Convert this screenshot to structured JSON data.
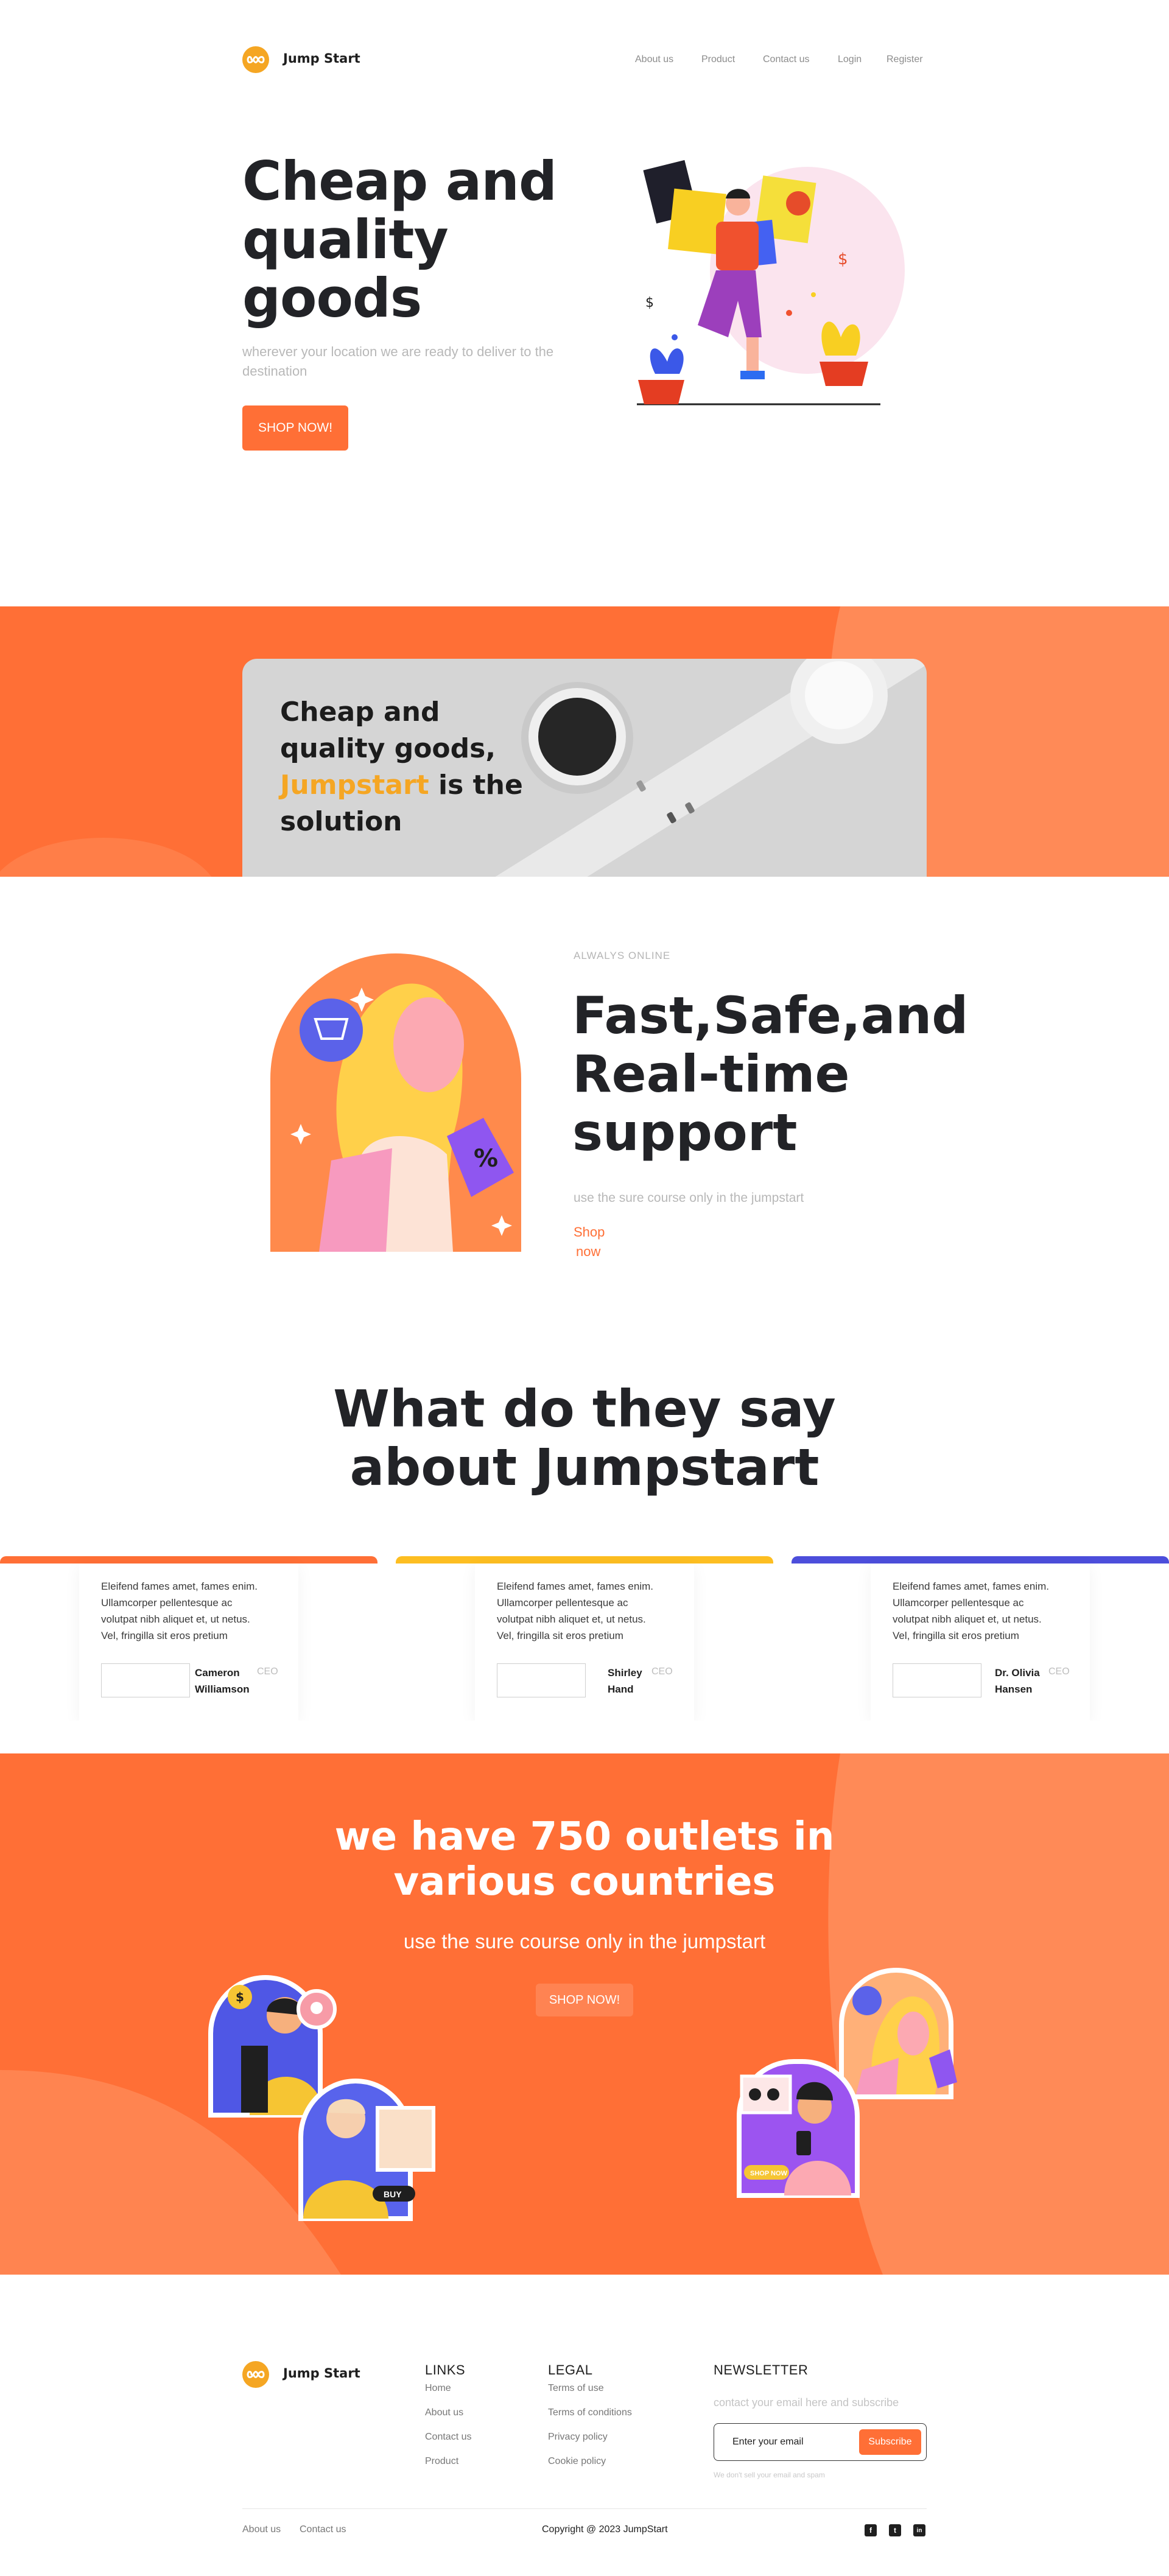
{
  "brand": {
    "name": "Jump Start",
    "accent": "#FF6F36",
    "logo_color": "#F5A623"
  },
  "nav": {
    "items": [
      "About us",
      "Product",
      "Contact us",
      "Login",
      "Register"
    ]
  },
  "hero": {
    "title_lines": [
      "Cheap and",
      "quality",
      "goods"
    ],
    "subtitle": "wherever your location we are ready to deliver to the destination",
    "cta": "SHOP NOW!"
  },
  "promo": {
    "line1": "Cheap and",
    "line2": "quality goods,",
    "highlight": "Jumpstart",
    "line3_rest": " is the",
    "line4": "solution"
  },
  "feature": {
    "eyebrow": "ALWALYS ONLINE",
    "title_lines": [
      "Fast,Safe,and",
      "Real-time",
      "support"
    ],
    "subtitle": "use the sure course only in the jumpstart",
    "link_lines": [
      "Shop",
      "now"
    ]
  },
  "testimonials": {
    "title_lines": [
      "What do they say",
      "about Jumpstart"
    ],
    "quote_lines": [
      "Eleifend fames amet, fames enim.",
      "Ullamcorper pellentesque ac",
      "volutpat nibh aliquet et, ut netus.",
      "Vel, fringilla sit eros pretium"
    ],
    "items": [
      {
        "name_lines": [
          "Cameron",
          "Williamson"
        ],
        "role": "CEO",
        "color": "#FF6F36"
      },
      {
        "name_lines": [
          "Shirley",
          "Hand"
        ],
        "role": "CEO",
        "color": "#FDBE21"
      },
      {
        "name_lines": [
          "Dr. Olivia",
          "Hansen"
        ],
        "role": "CEO",
        "color": "#4C4EDB"
      }
    ]
  },
  "outlets": {
    "title_lines": [
      "we have 750 outlets in",
      "various countries"
    ],
    "subtitle": "use the sure course only in the jumpstart",
    "cta": "SHOP NOW!",
    "buy_label": "BUY",
    "shop_label": "SHOP NOW"
  },
  "footer": {
    "links_heading": "LINKS",
    "links": [
      "Home",
      "About us",
      "Contact us",
      "Product"
    ],
    "legal_heading": "LEGAL",
    "legal": [
      "Terms of use",
      "Terms of conditions",
      "Privacy policy",
      "Cookie policy"
    ],
    "newsletter_heading": "NEWSLETTER",
    "newsletter_text": "contact your email here and subscribe",
    "email_placeholder": "Enter your email",
    "subscribe": "Subscribe",
    "disclaimer": "We don't sell your email and spam",
    "bottom_links": [
      "About us",
      "Contact us"
    ],
    "copyright": "Copyright @ 2023 JumpStart",
    "social": [
      {
        "icon": "facebook-icon",
        "glyph": "f"
      },
      {
        "icon": "twitter-icon",
        "glyph": "t"
      },
      {
        "icon": "linkedin-icon",
        "glyph": "in"
      }
    ]
  }
}
